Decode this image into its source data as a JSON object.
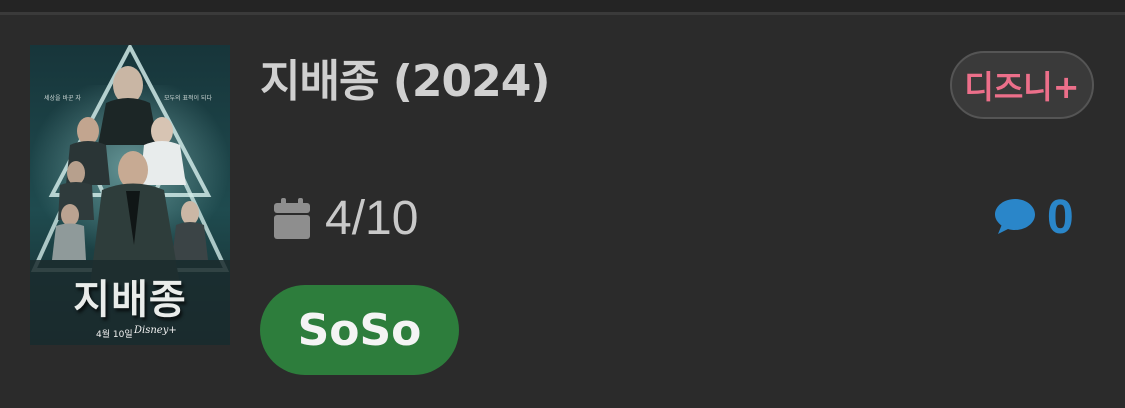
{
  "movie": {
    "title": "지배종 (2024)",
    "platform": "디즈니+",
    "rating": "4/10",
    "comment_count": "0",
    "status": "SoSo"
  },
  "poster": {
    "title_text": "지배종",
    "date_text": "4월 10일",
    "brand_text": "Disney+",
    "tagline_left": "세상을 바꾼 자",
    "tagline_right": "모두의 표적이 되다"
  },
  "icons": {
    "calendar": "calendar-icon",
    "comment": "comment-bubble-icon"
  },
  "colors": {
    "background": "#2b2b2b",
    "platform_badge_text": "#ec6f8a",
    "comment_accent": "#2a86c9",
    "status_pill": "#2d7d3c"
  }
}
